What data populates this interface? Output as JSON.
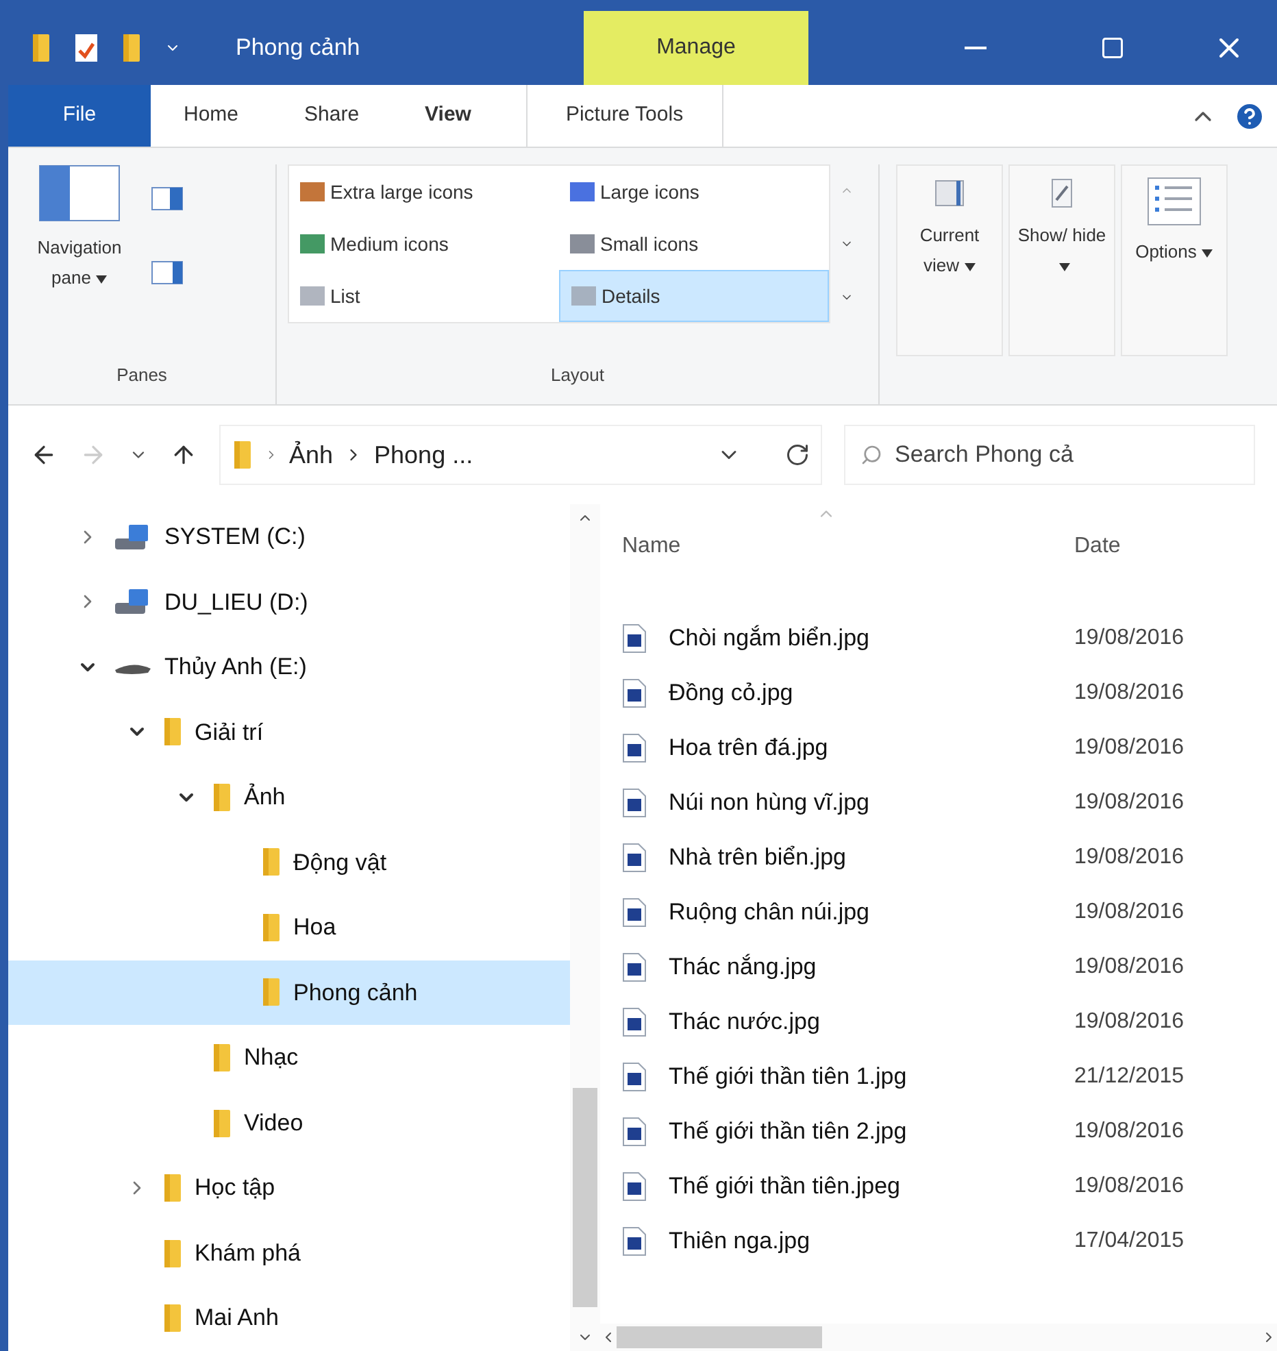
{
  "window": {
    "title": "Phong cảnh",
    "context_tab": "Manage"
  },
  "ribbon_tabs": [
    {
      "label": "File",
      "kind": "file",
      "selected": false
    },
    {
      "label": "Home",
      "kind": "normal",
      "selected": false
    },
    {
      "label": "Share",
      "kind": "normal",
      "selected": false
    },
    {
      "label": "View",
      "kind": "normal",
      "selected": true
    },
    {
      "label": "Picture Tools",
      "kind": "context",
      "selected": false
    }
  ],
  "panes_group": {
    "navigation_pane": "Navigation pane",
    "label": "Panes"
  },
  "layout_group": {
    "label": "Layout",
    "options": [
      {
        "label": "Extra large icons",
        "selected": false
      },
      {
        "label": "Large icons",
        "selected": false
      },
      {
        "label": "Medium icons",
        "selected": false
      },
      {
        "label": "Small icons",
        "selected": false
      },
      {
        "label": "List",
        "selected": false
      },
      {
        "label": "Details",
        "selected": true
      }
    ]
  },
  "view_buttons": [
    {
      "label": "Current view",
      "kind": "current"
    },
    {
      "label": "Show/ hide",
      "kind": "showhide"
    },
    {
      "label": "Options",
      "kind": "options"
    }
  ],
  "address_bar": {
    "path": [
      "Ảnh",
      "Phong ..."
    ],
    "search_placeholder": "Search Phong cả"
  },
  "navigation_tree": [
    {
      "label": "SYSTEM (C:)",
      "kind": "drive",
      "expanded": false,
      "selected": false
    },
    {
      "label": "DU_LIEU (D:)",
      "kind": "drive",
      "expanded": false,
      "selected": false
    },
    {
      "label": "Thủy Anh (E:)",
      "kind": "usb",
      "expanded": true,
      "selected": false,
      "children": [
        {
          "label": "Giải trí",
          "kind": "folder",
          "expanded": true,
          "selected": false,
          "children": [
            {
              "label": "Ảnh",
              "kind": "folder",
              "expanded": true,
              "selected": false,
              "children": [
                {
                  "label": "Động vật",
                  "kind": "folder",
                  "selected": false
                },
                {
                  "label": "Hoa",
                  "kind": "folder",
                  "selected": false
                },
                {
                  "label": "Phong cảnh",
                  "kind": "folder",
                  "selected": true
                }
              ]
            },
            {
              "label": "Nhạc",
              "kind": "folder",
              "selected": false
            },
            {
              "label": "Video",
              "kind": "folder",
              "selected": false
            }
          ]
        },
        {
          "label": "Học tập",
          "kind": "folder",
          "expanded": false,
          "selected": false
        },
        {
          "label": "Khám phá",
          "kind": "folder",
          "selected": false
        },
        {
          "label": "Mai Anh",
          "kind": "folder",
          "selected": false
        }
      ]
    }
  ],
  "file_list": {
    "columns": [
      "Name",
      "Date"
    ],
    "rows": [
      {
        "name": "Chòi ngắm biển.jpg",
        "date": "19/08/2016"
      },
      {
        "name": "Đồng cỏ.jpg",
        "date": "19/08/2016"
      },
      {
        "name": "Hoa trên đá.jpg",
        "date": "19/08/2016"
      },
      {
        "name": "Núi non hùng vĩ.jpg",
        "date": "19/08/2016"
      },
      {
        "name": "Nhà trên biển.jpg",
        "date": "19/08/2016"
      },
      {
        "name": "Ruộng chân núi.jpg",
        "date": "19/08/2016"
      },
      {
        "name": "Thác nắng.jpg",
        "date": "19/08/2016"
      },
      {
        "name": "Thác nước.jpg",
        "date": "19/08/2016"
      },
      {
        "name": "Thế giới thần tiên 1.jpg",
        "date": "21/12/2015"
      },
      {
        "name": "Thế giới thần tiên 2.jpg",
        "date": "19/08/2016"
      },
      {
        "name": "Thế giới thần tiên.jpeg",
        "date": "19/08/2016"
      },
      {
        "name": "Thiên nga.jpg",
        "date": "17/04/2015"
      }
    ]
  }
}
